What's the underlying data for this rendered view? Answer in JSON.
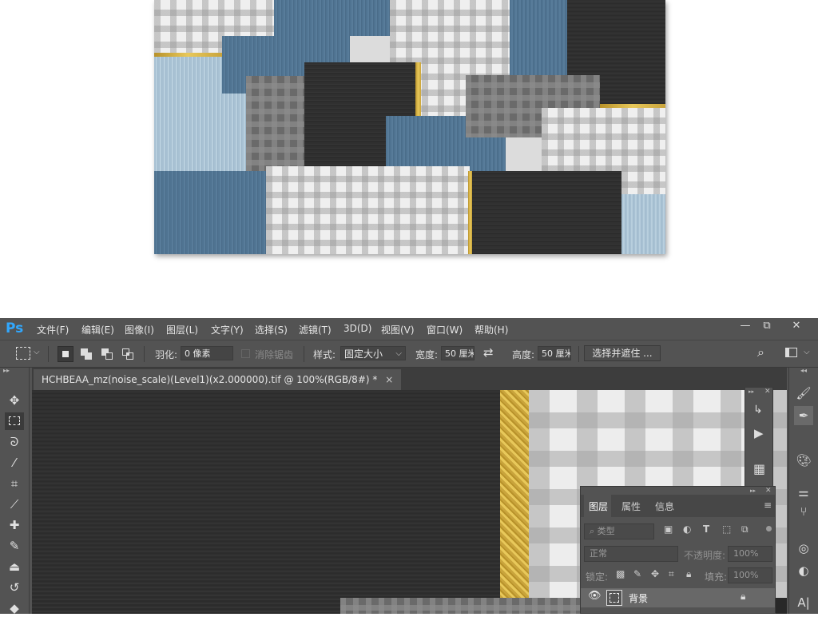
{
  "menubar": {
    "logo": "Ps",
    "items": [
      "文件(F)",
      "编辑(E)",
      "图像(I)",
      "图层(L)",
      "文字(Y)",
      "选择(S)",
      "滤镜(T)",
      "3D(D)",
      "视图(V)",
      "窗口(W)",
      "帮助(H)"
    ],
    "window_minimize": "—",
    "window_restore": "⧉",
    "window_close": "✕"
  },
  "options": {
    "feather_label": "羽化:",
    "feather_value": "0 像素",
    "antialias_label": "消除锯齿",
    "style_label": "样式:",
    "style_value": "固定大小",
    "width_label": "宽度:",
    "width_value": "50 厘米",
    "height_label": "高度:",
    "height_value": "50 厘米",
    "select_mask_button": "选择并遮住 ..."
  },
  "document": {
    "tab_title": "HCHBEAA_mz(noise_scale)(Level1)(x2.000000).tif @ 100%(RGB/8#) *",
    "tab_close": "×"
  },
  "layers_panel": {
    "tabs": [
      "图层",
      "属性",
      "信息"
    ],
    "filter_placeholder": "类型",
    "blend_mode": "正常",
    "opacity_label": "不透明度:",
    "opacity_value": "100%",
    "lock_label": "锁定:",
    "fill_label": "填充:",
    "fill_value": "100%",
    "layer_name": "背景"
  },
  "colors": {
    "ui_bg": "#535353",
    "ui_dark": "#3d3d3d",
    "ps_blue": "#31a8ff",
    "gold": "#d4b04a",
    "steel_blue": "#4f7391"
  }
}
